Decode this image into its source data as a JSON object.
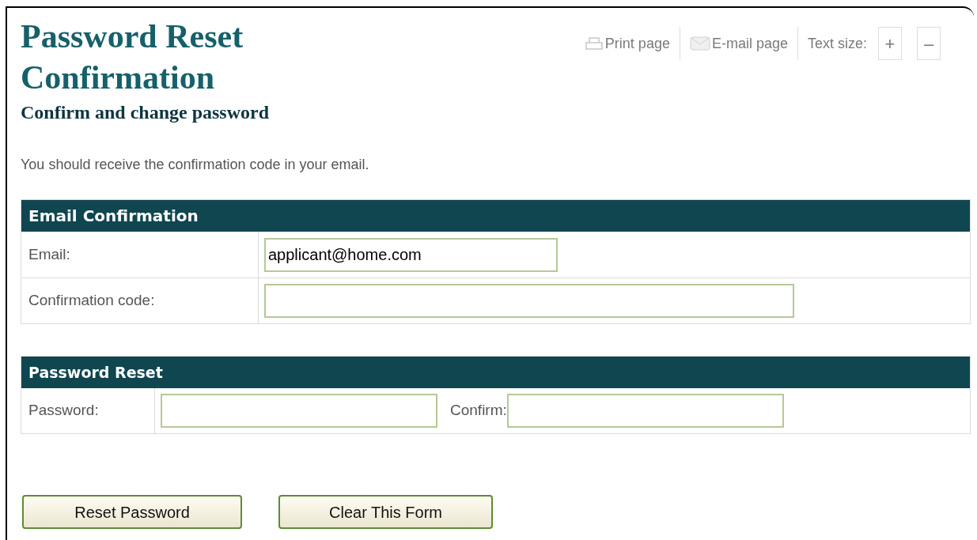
{
  "title": "Password Reset Confirmation",
  "subtitle": "Confirm and change password",
  "toolbar": {
    "print": "Print page",
    "email": "E-mail page",
    "text_size_label": "Text size:",
    "increase": "+",
    "decrease": "–"
  },
  "intro": "You should receive the confirmation code in your email.",
  "email_section": {
    "heading": "Email Confirmation",
    "fields": [
      {
        "label": "Email:",
        "value": "applicant@home.com",
        "kind": "short"
      },
      {
        "label": "Confirmation code:",
        "kind": "long"
      }
    ]
  },
  "password_section": {
    "heading": "Password Reset",
    "password_label": "Password:",
    "confirm_label": "Confirm:"
  },
  "buttons": [
    "Reset Password",
    "Clear This Form"
  ]
}
